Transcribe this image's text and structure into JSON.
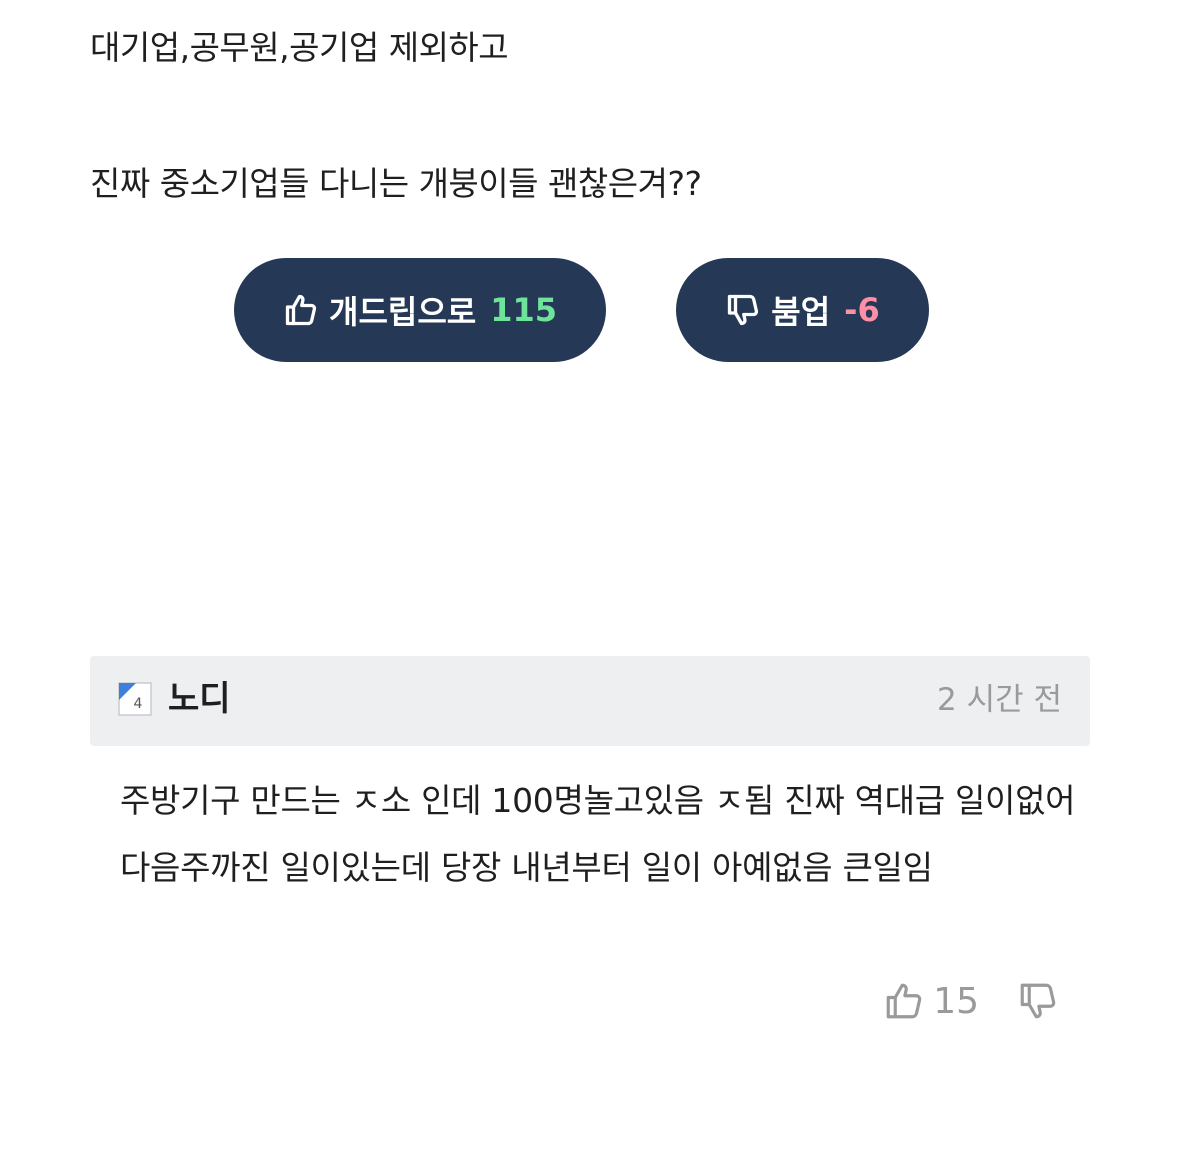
{
  "post": {
    "line1": "대기업,공무원,공기업 제외하고",
    "line2": "진짜 중소기업들 다니는 개붕이들 괜찮은겨??"
  },
  "votes": {
    "upvote_label": "개드립으로",
    "upvote_count": "115",
    "downvote_label": "붐업",
    "downvote_count": "-6"
  },
  "comment": {
    "level_badge": "4",
    "author": "노디",
    "time": "2 시간 전",
    "body": "주방기구 만드는 ㅈ소 인데 100명놀고있음 ㅈ됨 진짜 역대급 일이없어 다음주까진 일이있는데 당장 내년부터 일이 아예없음 큰일임",
    "like_count": "15"
  },
  "colors": {
    "button_bg": "#253956",
    "upvote_count": "#6ee39a",
    "downvote_count": "#ff8fa6",
    "header_bg": "#eeeff1",
    "muted_text": "#9a9a9a"
  },
  "icons": {
    "upvote": "thumbs-up-icon",
    "downvote": "thumbs-down-icon",
    "level": "level-badge-icon"
  }
}
